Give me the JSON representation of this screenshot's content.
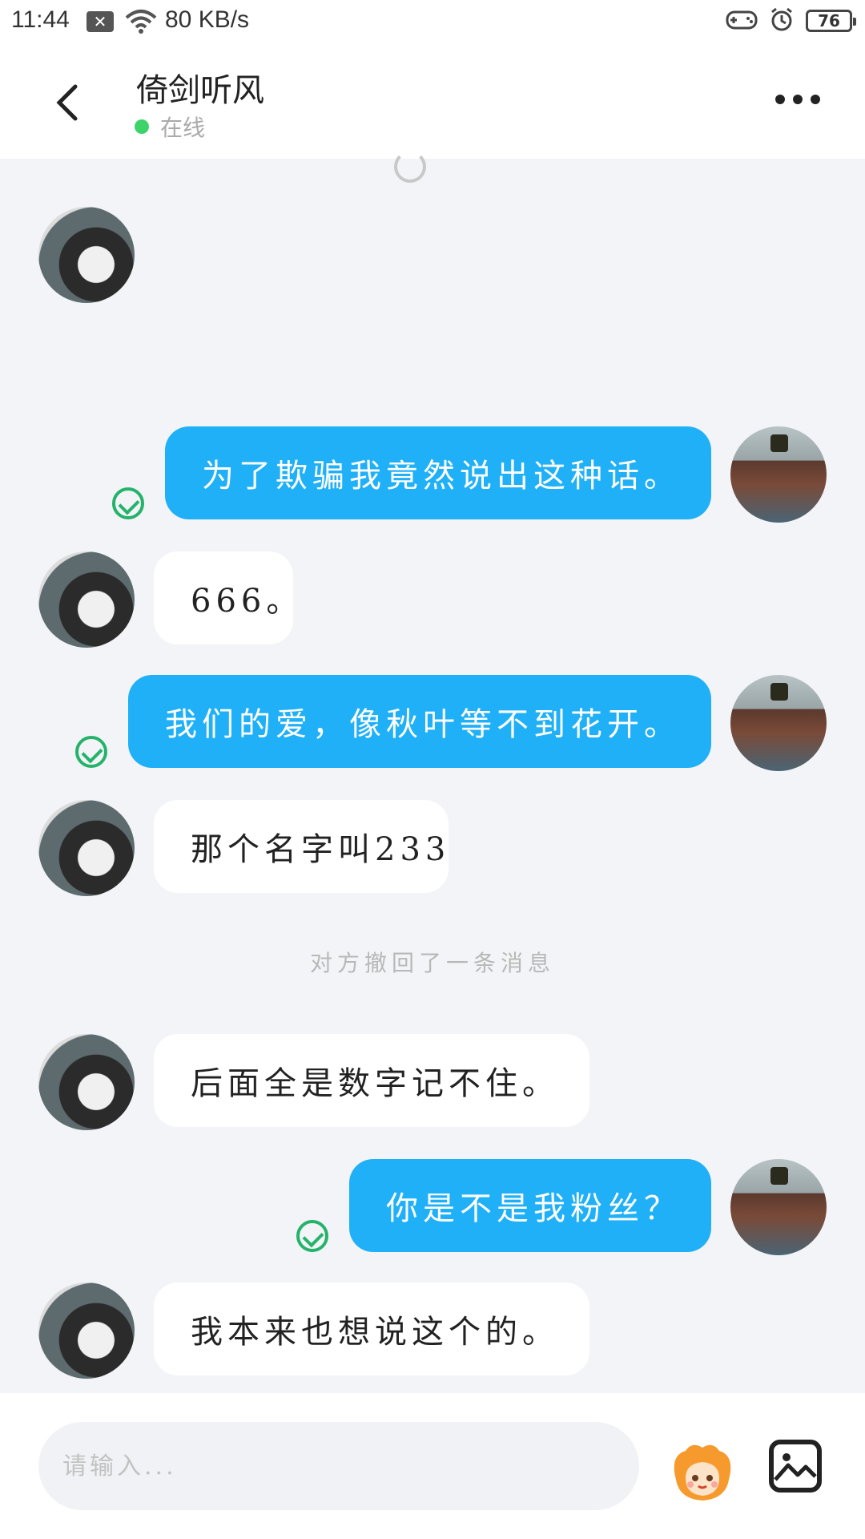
{
  "status_bar": {
    "time": "11:44",
    "net_speed": "80 KB/s",
    "battery": "76"
  },
  "header": {
    "title": "倚剑听风",
    "status": "在线"
  },
  "messages": [
    {
      "side": "self",
      "text": "为了欺骗我竟然说出这种话。"
    },
    {
      "side": "other",
      "text": "666。"
    },
    {
      "side": "self",
      "text": "我们的爱，像秋叶等不到花开。"
    },
    {
      "side": "other",
      "text": "那个名字叫233"
    },
    {
      "side": "other",
      "text": "后面全是数字记不住。"
    },
    {
      "side": "self",
      "text": "你是不是我粉丝？"
    },
    {
      "side": "other",
      "text": "我本来也想说这个的。"
    }
  ],
  "system_note": "对方撤回了一条消息",
  "input": {
    "placeholder": "请输入..."
  },
  "colors": {
    "self_bubble": "#1fb0f7",
    "other_bubble": "#ffffff",
    "online": "#3cd36a",
    "read_check": "#25b36b"
  }
}
